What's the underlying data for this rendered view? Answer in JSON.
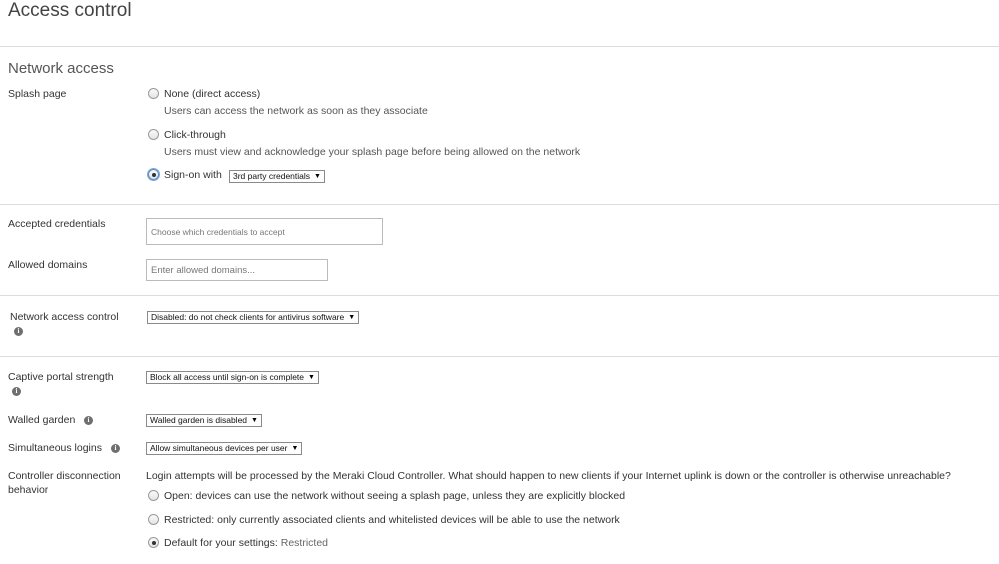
{
  "page": {
    "title": "Access control"
  },
  "network_access": {
    "section_title": "Network access",
    "splash_page": {
      "label": "Splash page",
      "options": [
        {
          "label": "None (direct access)",
          "description": "Users can access the network as soon as they associate",
          "selected": false
        },
        {
          "label": "Click-through",
          "description": "Users must view and acknowledge your splash page before being allowed on the network",
          "selected": false
        },
        {
          "label": "Sign-on with",
          "selected": true,
          "select_value": "3rd party credentials"
        }
      ]
    },
    "accepted_credentials": {
      "label": "Accepted credentials",
      "placeholder": "Choose which credentials to accept"
    },
    "allowed_domains": {
      "label": "Allowed domains",
      "placeholder": "Enter allowed domains..."
    },
    "network_access_control": {
      "label": "Network access control",
      "select_value": "Disabled: do not check clients for antivirus software"
    },
    "captive_portal_strength": {
      "label": "Captive portal strength",
      "select_value": "Block all access until sign-on is complete"
    },
    "walled_garden": {
      "label": "Walled garden",
      "select_value": "Walled garden is disabled"
    },
    "simultaneous_logins": {
      "label": "Simultaneous logins",
      "select_value": "Allow simultaneous devices per user"
    },
    "controller_disconnection": {
      "label_line1": "Controller disconnection",
      "label_line2": "behavior",
      "description": "Login attempts will be processed by the Meraki Cloud Controller. What should happen to new clients if your Internet uplink is down or the controller is otherwise unreachable?",
      "options": [
        {
          "label": "Open: devices can use the network without seeing a splash page, unless they are explicitly blocked",
          "selected": false
        },
        {
          "label": "Restricted: only currently associated clients and whitelisted devices will be able to use the network",
          "selected": false
        },
        {
          "label": "Default for your settings:",
          "value": "Restricted",
          "selected": true
        }
      ]
    }
  },
  "icons": {
    "info": "info-icon",
    "dropdown": "chevron-down-icon"
  }
}
